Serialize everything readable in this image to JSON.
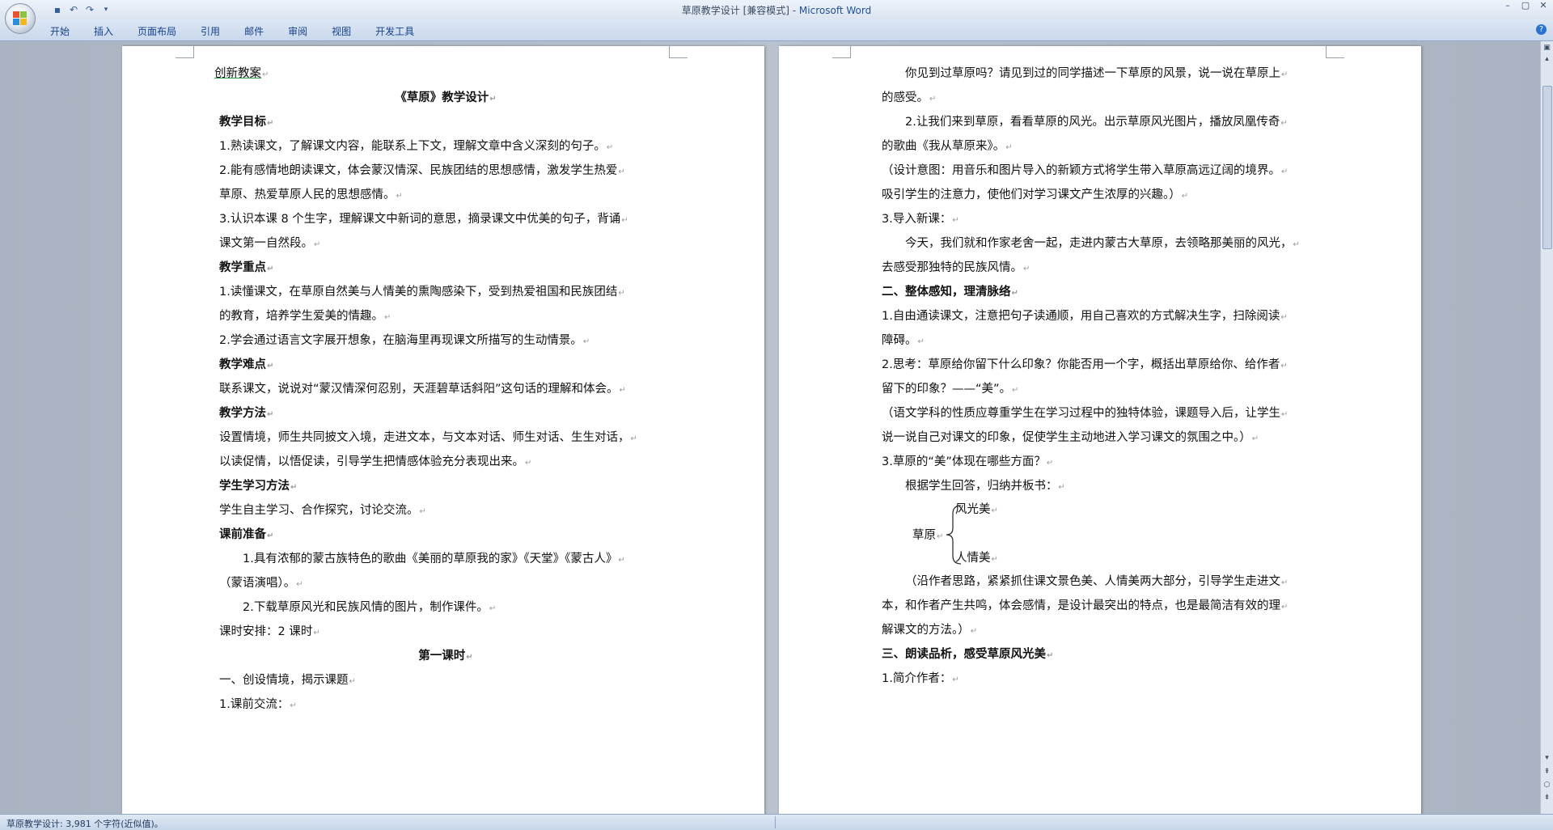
{
  "window": {
    "title": "草原教学设计 [兼容模式] - ",
    "app_name": "Microsoft Word",
    "controls": [
      "–",
      "▢",
      "✕"
    ]
  },
  "quick_access": [
    "save-icon",
    "undo-icon",
    "redo-icon",
    "customize-icon"
  ],
  "ribbon": {
    "tabs": [
      "开始",
      "插入",
      "页面布局",
      "引用",
      "邮件",
      "审阅",
      "视图",
      "开发工具"
    ]
  },
  "left_page": {
    "lines": [
      {
        "text": "创新教案",
        "style": "link"
      },
      {
        "text": "《草原》教学设计",
        "style": "bold-center"
      },
      {
        "text": "教学目标",
        "style": "bold"
      },
      {
        "text": "1.熟读课文，了解课文内容，能联系上下文，理解文章中含义深刻的句子。",
        "style": "normal"
      },
      {
        "text": "2.能有感情地朗读课文，体会蒙汉情深、民族团结的思想感情，激发学生热爱",
        "style": "normal"
      },
      {
        "text": "草原、热爱草原人民的思想感情。",
        "style": "normal"
      },
      {
        "text": "3.认识本课 8 个生字，理解课文中新词的意思，摘录课文中优美的句子，背诵",
        "style": "normal"
      },
      {
        "text": "课文第一自然段。",
        "style": "normal"
      },
      {
        "text": "教学重点",
        "style": "bold"
      },
      {
        "text": "1.读懂课文，在草原自然美与人情美的熏陶感染下，受到热爱祖国和民族团结",
        "style": "normal"
      },
      {
        "text": "的教育，培养学生爱美的情趣。",
        "style": "normal"
      },
      {
        "text": "2.学会通过语言文字展开想象，在脑海里再现课文所描写的生动情景。",
        "style": "normal"
      },
      {
        "text": "教学难点",
        "style": "bold"
      },
      {
        "text": "联系课文，说说对“蒙汉情深何忍别，天涯碧草话斜阳”这句话的理解和体会。",
        "style": "normal"
      },
      {
        "text": "教学方法",
        "style": "bold"
      },
      {
        "text": "设置情境，师生共同披文入境，走进文本，与文本对话、师生对话、生生对话，",
        "style": "normal"
      },
      {
        "text": "以读促情，以悟促读，引导学生把情感体验充分表现出来。",
        "style": "normal"
      },
      {
        "text": "学生学习方法",
        "style": "bold"
      },
      {
        "text": "学生自主学习、合作探究，讨论交流。",
        "style": "normal"
      },
      {
        "text": "课前准备",
        "style": "bold"
      },
      {
        "text": "1.具有浓郁的蒙古族特色的歌曲《美丽的草原我的家》《天堂》《蒙古人》",
        "style": "indent"
      },
      {
        "text": "（蒙语演唱）。",
        "style": "normal"
      },
      {
        "text": "2.下载草原风光和民族风情的图片，制作课件。",
        "style": "indent"
      },
      {
        "text": "课时安排：2 课时",
        "style": "mixed"
      },
      {
        "text": "第一课时",
        "style": "bold-center"
      },
      {
        "text": "一、创设情境，揭示课题",
        "style": "normal"
      },
      {
        "text": "1.课前交流：",
        "style": "normal"
      }
    ]
  },
  "right_page": {
    "lines_top": [
      {
        "text": "你见到过草原吗？请见到过的同学描述一下草原的风景，说一说在草原上",
        "style": "indent"
      },
      {
        "text": "的感受。",
        "style": "normal"
      },
      {
        "text": "2.让我们来到草原，看看草原的风光。出示草原风光图片，播放凤凰传奇",
        "style": "indent"
      },
      {
        "text": "的歌曲《我从草原来》。",
        "style": "normal"
      },
      {
        "text": "（设计意图：用音乐和图片导入的新颖方式将学生带入草原高远辽阔的境界。",
        "style": "normal"
      },
      {
        "text": "吸引学生的注意力，使他们对学习课文产生浓厚的兴趣。）",
        "style": "normal"
      },
      {
        "text": "3.导入新课：",
        "style": "normal"
      },
      {
        "text": "今天，我们就和作家老舍一起，走进内蒙古大草原，去领略那美丽的风光，",
        "style": "indent"
      },
      {
        "text": "去感受那独特的民族风情。",
        "style": "normal"
      },
      {
        "text": "二、整体感知，理清脉络",
        "style": "bold"
      },
      {
        "text": "1.自由通读课文，注意把句子读通顺，用自己喜欢的方式解决生字，扫除阅读",
        "style": "normal"
      },
      {
        "text": "障碍。",
        "style": "normal"
      },
      {
        "text": "2.思考：草原给你留下什么印象？你能否用一个字，概括出草原给你、给作者",
        "style": "normal"
      },
      {
        "text": "留下的印象？——“美”。",
        "style": "normal"
      },
      {
        "text": "（语文学科的性质应尊重学生在学习过程中的独特体验，课题导入后，让学生",
        "style": "normal"
      },
      {
        "text": "说一说自己对课文的印象，促使学生主动地进入学习课文的氛围之中。）",
        "style": "normal"
      },
      {
        "text": "3.草原的“美”体现在哪些方面？",
        "style": "normal"
      },
      {
        "text": "根据学生回答，归纳并板书：",
        "style": "indent"
      }
    ],
    "diagram": {
      "root": "草原",
      "branch_top": "风光美",
      "branch_bottom": "人情美"
    },
    "lines_bottom": [
      {
        "text": "（沿作者思路，紧紧抓住课文景色美、人情美两大部分，引导学生走进文",
        "style": "indent"
      },
      {
        "text": "本，和作者产生共鸣，体会感情，是设计最突出的特点，也是最简洁有效的理",
        "style": "normal"
      },
      {
        "text": "解课文的方法。）",
        "style": "normal"
      },
      {
        "text": "三、朗读品析，感受草原风光美",
        "style": "bold"
      },
      {
        "text": "1.简介作者：",
        "style": "normal"
      }
    ]
  },
  "statusbar": {
    "text": "草原教学设计: 3,981 个字符(近似值)。"
  }
}
